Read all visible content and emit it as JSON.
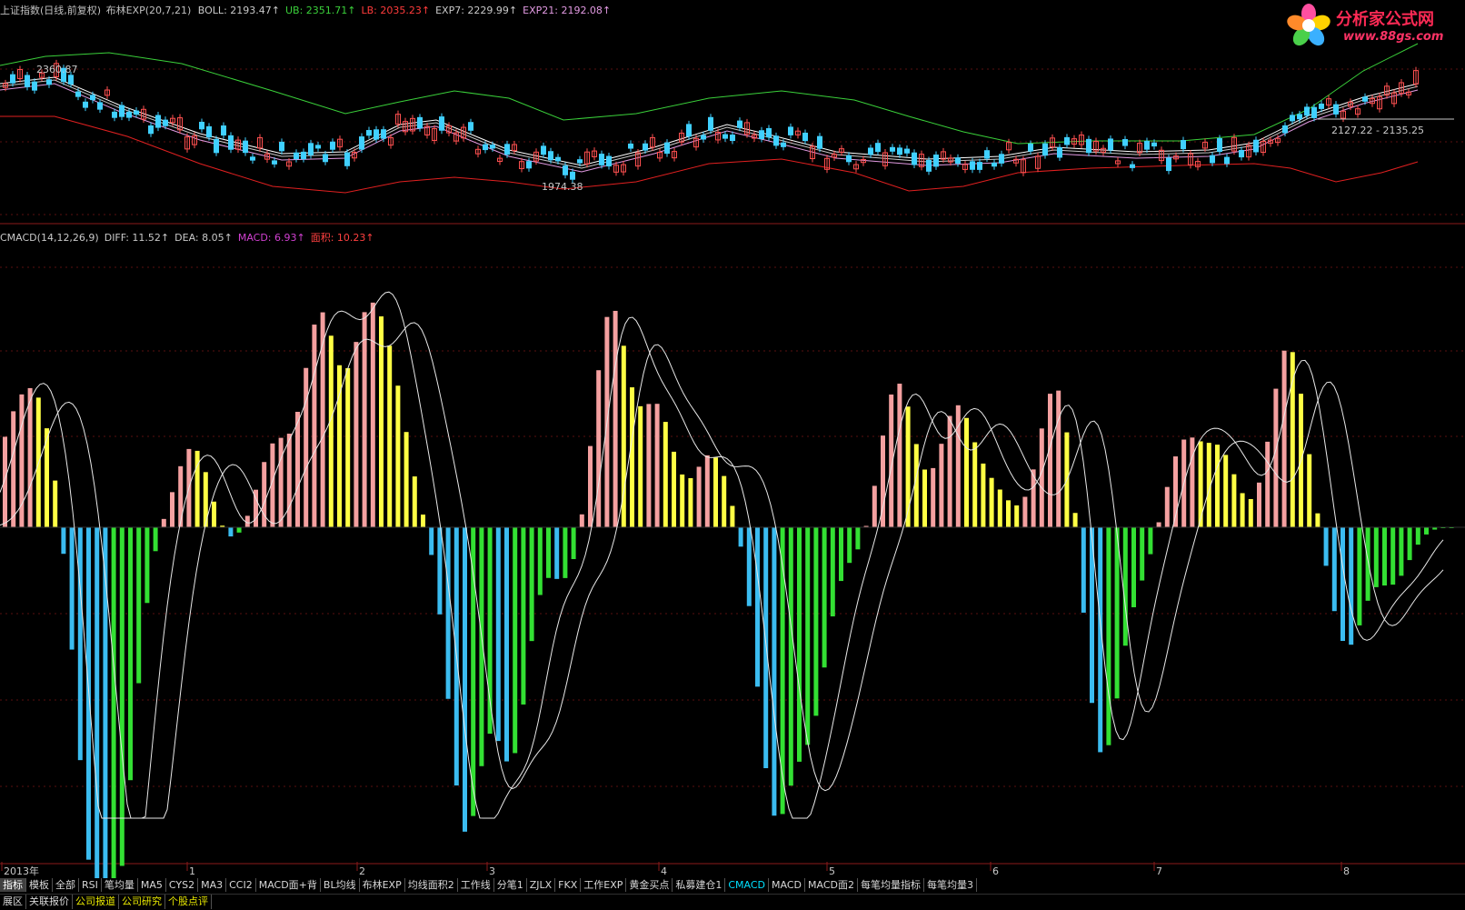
{
  "upper_panel": {
    "title": "上证指数(日线,前复权)",
    "indicator": "布林EXP(20,7,21)",
    "values": [
      {
        "label": "BOLL: 2193.47↑",
        "color": "#c8c8c8"
      },
      {
        "label": "UB: 2351.71↑",
        "color": "#3ad03a"
      },
      {
        "label": "LB: 2035.23↑",
        "color": "#ff3b3b"
      },
      {
        "label": "EXP7: 2229.99↑",
        "color": "#c8c8c8"
      },
      {
        "label": "EXP21: 2192.08↑",
        "color": "#e29ae2"
      }
    ],
    "annotations": {
      "high": "2360.87",
      "low": "1974.38",
      "range": "2127.22 - 2135.25"
    }
  },
  "lower_panel": {
    "values": [
      {
        "label": "CMACD(14,12,26,9)",
        "color": "#c8c8c8"
      },
      {
        "label": "DIFF: 11.52↑",
        "color": "#c8c8c8"
      },
      {
        "label": "DEA: 8.05↑",
        "color": "#c8c8c8"
      },
      {
        "label": "MACD: 6.93↑",
        "color": "#d040d0"
      },
      {
        "label": "面积: 10.23↑",
        "color": "#ff4040"
      }
    ]
  },
  "time_axis": [
    "2013年",
    "1",
    "2",
    "3",
    "4",
    "5",
    "6",
    "7",
    "8"
  ],
  "logo": {
    "site": "分析家公式网",
    "url": "www.88gs.com"
  },
  "indicator_tabs": [
    "指标",
    "模板",
    "全部",
    "RSI",
    "笔均量",
    "MA5",
    "CYS2",
    "MA3",
    "CCI2",
    "MACD面+背",
    "BL均线",
    "布林EXP",
    "均线面积2",
    "工作线",
    "分笔1",
    "ZJLX",
    "FKX",
    "工作EXP",
    "黄金买点",
    "私募建仓1",
    "CMACD",
    "MACD",
    "MACD面2",
    "每笔均量指标",
    "每笔均量3"
  ],
  "bottom_tabs": [
    {
      "label": "展区",
      "color": "#d8d8d8"
    },
    {
      "label": "关联报价",
      "color": "#d8d8d8"
    },
    {
      "label": "公司报道",
      "color": "#e8e800"
    },
    {
      "label": "公司研究",
      "color": "#e8e800"
    },
    {
      "label": "个股点评",
      "color": "#e8e800"
    }
  ],
  "colors": {
    "background": "#000000",
    "boll_mid": "#c8c8c8",
    "upper_band": "#3ad03a",
    "lower_band": "#e02020",
    "exp21": "#e29ae2",
    "candle_up": "#ff5050",
    "candle_down": "#40d0ff",
    "hist_pos_rising": "#f4a0a0",
    "hist_pos_falling": "#ffff44",
    "hist_neg_falling": "#3bbcf0",
    "hist_neg_rising": "#33e033",
    "separator": "#8b1a1a"
  }
}
